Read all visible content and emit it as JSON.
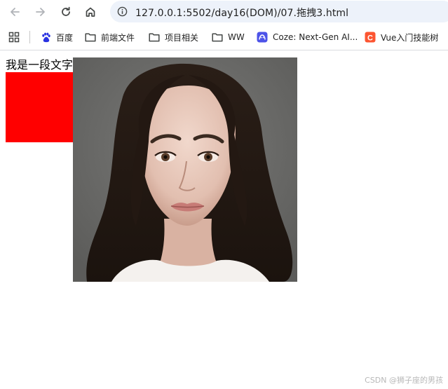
{
  "browser": {
    "url": "127.0.0.1:5502/day16(DOM)/07.拖拽3.html",
    "bookmarks": [
      {
        "label": "百度",
        "icon": "baidu-paw-icon"
      },
      {
        "label": "前端文件",
        "icon": "folder-icon"
      },
      {
        "label": "项目相关",
        "icon": "folder-icon"
      },
      {
        "label": "WW",
        "icon": "folder-icon"
      },
      {
        "label": "Coze: Next-Gen AI...",
        "icon": "coze-icon"
      },
      {
        "label": "Vue入门技能树",
        "icon": "csdn-c-icon"
      }
    ]
  },
  "page": {
    "paragraph": "我是一段文字",
    "box_color": "#ff0000",
    "image_alt": "portrait photo"
  },
  "watermark": "CSDN @狮子座的男孩",
  "colors": {
    "omnibox_bg": "#edf2fa",
    "accent_red": "#ff0000"
  }
}
